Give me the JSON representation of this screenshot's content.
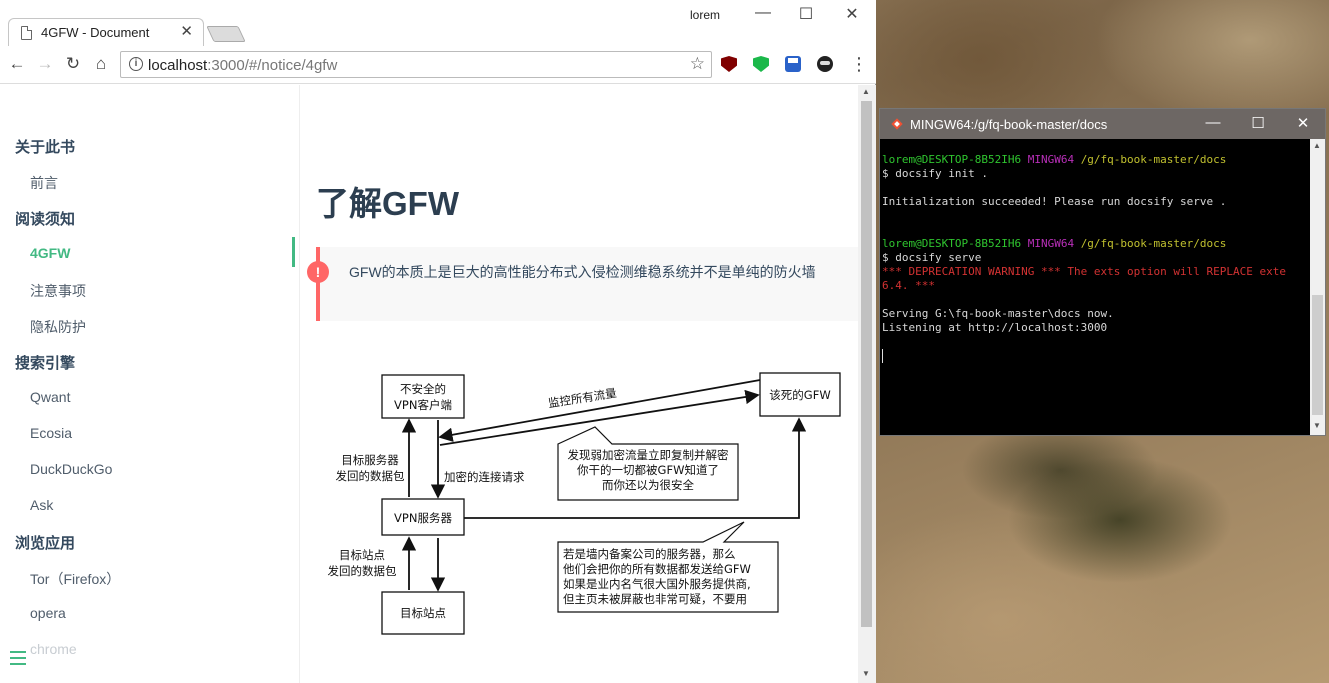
{
  "browser": {
    "tab_title": "4GFW - Document",
    "tab_close": "✕",
    "user": "lorem",
    "url_host": "localhost",
    "url_path": ":3000/#/notice/4gfw",
    "controls": {
      "minimize": "—",
      "maximize": "☐",
      "close": "✕"
    }
  },
  "sidebar": {
    "sections": [
      {
        "title": "关于此书",
        "items": [
          "前言"
        ]
      },
      {
        "title": "阅读须知",
        "items": [
          "4GFW",
          "注意事项",
          "隐私防护"
        ]
      },
      {
        "title": "搜索引擎",
        "items": [
          "Qwant",
          "Ecosia",
          "DuckDuckGo",
          "Ask"
        ]
      },
      {
        "title": "浏览应用",
        "items": [
          "Tor（Firefox）",
          "opera",
          "chrome"
        ]
      }
    ],
    "active_item": "4GFW"
  },
  "content": {
    "heading": "了解GFW",
    "tip_icon": "!",
    "tip": "GFW的本质上是巨大的高性能分布式入侵检测维稳系统并不是单纯的防火墙",
    "diagram": {
      "vpn_client": [
        "不安全的",
        "VPN客户端"
      ],
      "gfw": "该死的GFW",
      "vpn_server": "VPN服务器",
      "target_site": "目标站点",
      "monitor_label": "监控所有流量",
      "encrypted_label": "加密的连接请求",
      "server_return": [
        "目标服务器",
        "发回的数据包"
      ],
      "site_return": [
        "目标站点",
        "发回的数据包"
      ],
      "note1": [
        "发现弱加密流量立即复制并解密",
        "你干的一切都被GFW知道了",
        "而你还以为很安全"
      ],
      "note2": [
        "若是墙内备案公司的服务器，那么",
        "他们会把你的所有数据都发送给GFW",
        "如果是业内名气很大国外服务提供商,",
        "但主页未被屏蔽也非常可疑，不要用"
      ]
    }
  },
  "terminal": {
    "title": "MINGW64:/g/fq-book-master/docs",
    "prompt_user": "lorem@DESKTOP-8B52IH6",
    "prompt_env": "MINGW64",
    "prompt_path": "/g/fq-book-master/docs",
    "cmd1": "$ docsify init .",
    "out1": "Initialization succeeded! Please run docsify serve .",
    "cmd2": "$ docsify serve",
    "warn1": "*** DEPRECATION WARNING *** The exts option will REPLACE exte",
    "warn2": "6.4. ***",
    "out2": "Serving G:\\fq-book-master\\docs now.",
    "out3": "Listening at http://localhost:3000"
  },
  "colors": {
    "accent": "#42b983",
    "tip_border": "#ff6666",
    "heading": "#2c3e50",
    "terminal_bg": "#000000"
  }
}
